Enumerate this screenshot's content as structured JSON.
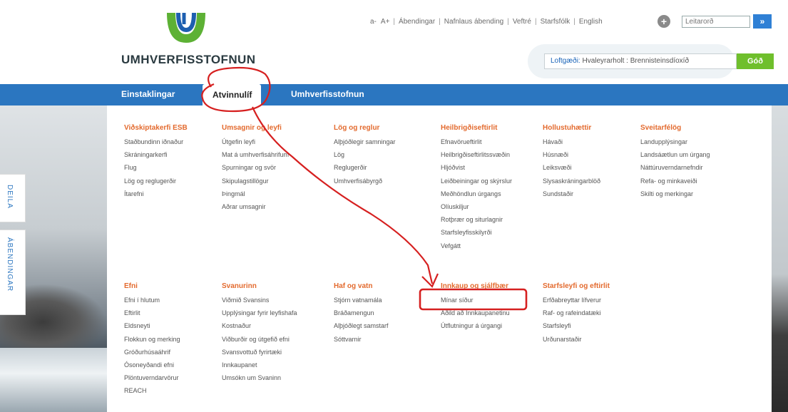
{
  "brand": {
    "name": "UMHVERFISSTOFNUN",
    "colors": {
      "primary": "#2b76c0",
      "accent": "#e36a2e",
      "good": "#6fbf2c",
      "annotation": "#d62020"
    }
  },
  "top_links": {
    "font_small": "a-",
    "font_large": "A+",
    "items": [
      "Ábendingar",
      "Nafnlaus ábending",
      "Veftré",
      "Starfsfólk",
      "English"
    ]
  },
  "search": {
    "placeholder": "Leitarorð",
    "button": "»",
    "icon": "globe-icon"
  },
  "air_quality": {
    "label": "Loftgæði:",
    "station": "Hvaleyrarholt : Brennisteinsdíoxíð",
    "status": "Góð"
  },
  "nav": {
    "items": [
      "Einstaklingar",
      "Atvinnulíf",
      "Umhverfisstofnun"
    ],
    "active": "Atvinnulíf"
  },
  "side_tabs": {
    "share": "DEILA",
    "feedback": "ÁBENDINGAR"
  },
  "menu": {
    "top_row": [
      {
        "title": "Viðskiptakerfi ESB",
        "items": [
          "Staðbundinn iðnaður",
          "Skráningarkerfi",
          "Flug",
          "Lög og reglugerðir",
          "Ítarefni"
        ]
      },
      {
        "title": "Umsagnir og leyfi",
        "items": [
          "Útgefin leyfi",
          "Mat á umhverfisáhrifum",
          "Spurningar og svör",
          "Skipulagstillögur",
          "Þingmál",
          "Aðrar umsagnir"
        ]
      },
      {
        "title": "Lög og reglur",
        "items": [
          "Alþjóðlegir samningar",
          "Lög",
          "Reglugerðir",
          "Umhverfisábyrgð"
        ]
      },
      {
        "title": "Heilbrigðiseftirlit",
        "items": [
          "Efnavörueftirlit",
          "Heilbrigðiseftirlitssvæðin",
          "Hljóðvist",
          "Leiðbeiningar og skýrslur",
          "Meðhöndlun úrgangs",
          "Olíuskiljur",
          "Rotþrær og siturlagnir",
          "Starfsleyfisskilyrði",
          "Vefgátt"
        ]
      },
      {
        "title": "Hollustuhættir",
        "items": [
          "Hávaði",
          "Húsnæði",
          "Leiksvæði",
          "Slysaskráningarblöð",
          "Sundstaðir"
        ]
      },
      {
        "title": "Sveitarfélög",
        "items": [
          "Landupplýsingar",
          "Landsáætlun um úrgang",
          "Náttúruverndarnefndir",
          "Refa- og minkaveiði",
          "Skilti og merkingar"
        ]
      }
    ],
    "bottom_row": [
      {
        "title": "Efni",
        "items": [
          "Efni í hlutum",
          "Eftirlit",
          "Eldsneyti",
          "Flokkun og merking",
          "Gróðurhúsaáhrif",
          "Ósoneyðandi efni",
          "Plöntuverndarvörur",
          "REACH"
        ]
      },
      {
        "title": "Svanurinn",
        "items": [
          "Viðmið Svansins",
          "Upplýsingar fyrir leyfishafa",
          "Kostnaður",
          "Viðburðir og útgefið efni",
          "Svansvottuð fyrirtæki",
          "Innkaupanet",
          "Umsókn um Svaninn"
        ]
      },
      {
        "title": "Haf og vatn",
        "items": [
          "Stjórn vatnamála",
          "Bráðamengun",
          "Alþjóðlegt samstarf",
          "Sóttvarnir"
        ]
      },
      {
        "title": "Innkaup og sjálfbær",
        "items": [
          "Mínar síður",
          "Aðild að Innkaupanetinu",
          "Útflutningur á úrgangi"
        ]
      },
      {
        "title": "Starfsleyfi og eftirlit",
        "items": [
          "Erfðabreyttar lífverur",
          "Raf- og rafeindatæki",
          "Starfsleyfi",
          "Urðunarstaðir"
        ]
      }
    ]
  }
}
